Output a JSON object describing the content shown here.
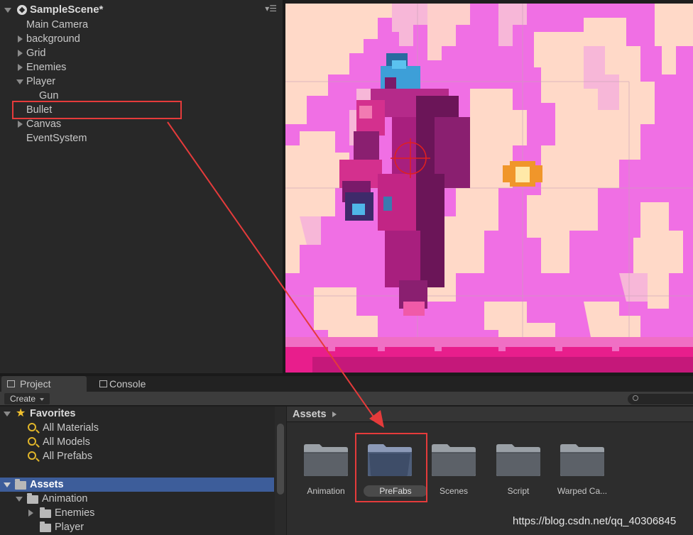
{
  "hierarchy": {
    "scene_name": "SampleScene*",
    "items": [
      {
        "label": "Main Camera",
        "indent": 0,
        "expander": "none"
      },
      {
        "label": "background",
        "indent": 0,
        "expander": "collapsed"
      },
      {
        "label": "Grid",
        "indent": 0,
        "expander": "collapsed"
      },
      {
        "label": "Enemies",
        "indent": 0,
        "expander": "collapsed"
      },
      {
        "label": "Player",
        "indent": 0,
        "expander": "expanded"
      },
      {
        "label": "Gun",
        "indent": 1,
        "expander": "none"
      },
      {
        "label": "Bullet",
        "indent": 0,
        "expander": "none"
      },
      {
        "label": "Canvas",
        "indent": 0,
        "expander": "collapsed"
      },
      {
        "label": "EventSystem",
        "indent": 0,
        "expander": "none"
      }
    ]
  },
  "tabs": {
    "project": "Project",
    "console": "Console"
  },
  "toolbar": {
    "create_label": "Create"
  },
  "project_tree": {
    "favorites_label": "Favorites",
    "favorites": [
      "All Materials",
      "All Models",
      "All Prefabs"
    ],
    "assets_label": "Assets",
    "assets_children": [
      {
        "label": "Animation",
        "indent": 1,
        "expander": "expanded"
      },
      {
        "label": "Enemies",
        "indent": 2,
        "expander": "collapsed"
      },
      {
        "label": "Player",
        "indent": 2,
        "expander": "none"
      }
    ]
  },
  "assets_panel": {
    "breadcrumb": "Assets",
    "folders": [
      "Animation",
      "PreFabs",
      "Scenes",
      "Script",
      "Warped Ca..."
    ],
    "selected_folder": "PreFabs"
  },
  "watermark": "https://blog.csdn.net/qq_40306845",
  "colors": {
    "highlight_box": "#e53b3b",
    "selection_blue": "#3d5d9a",
    "scene_pink": "#f06fe4",
    "scene_peach": "#ffd9c8"
  }
}
